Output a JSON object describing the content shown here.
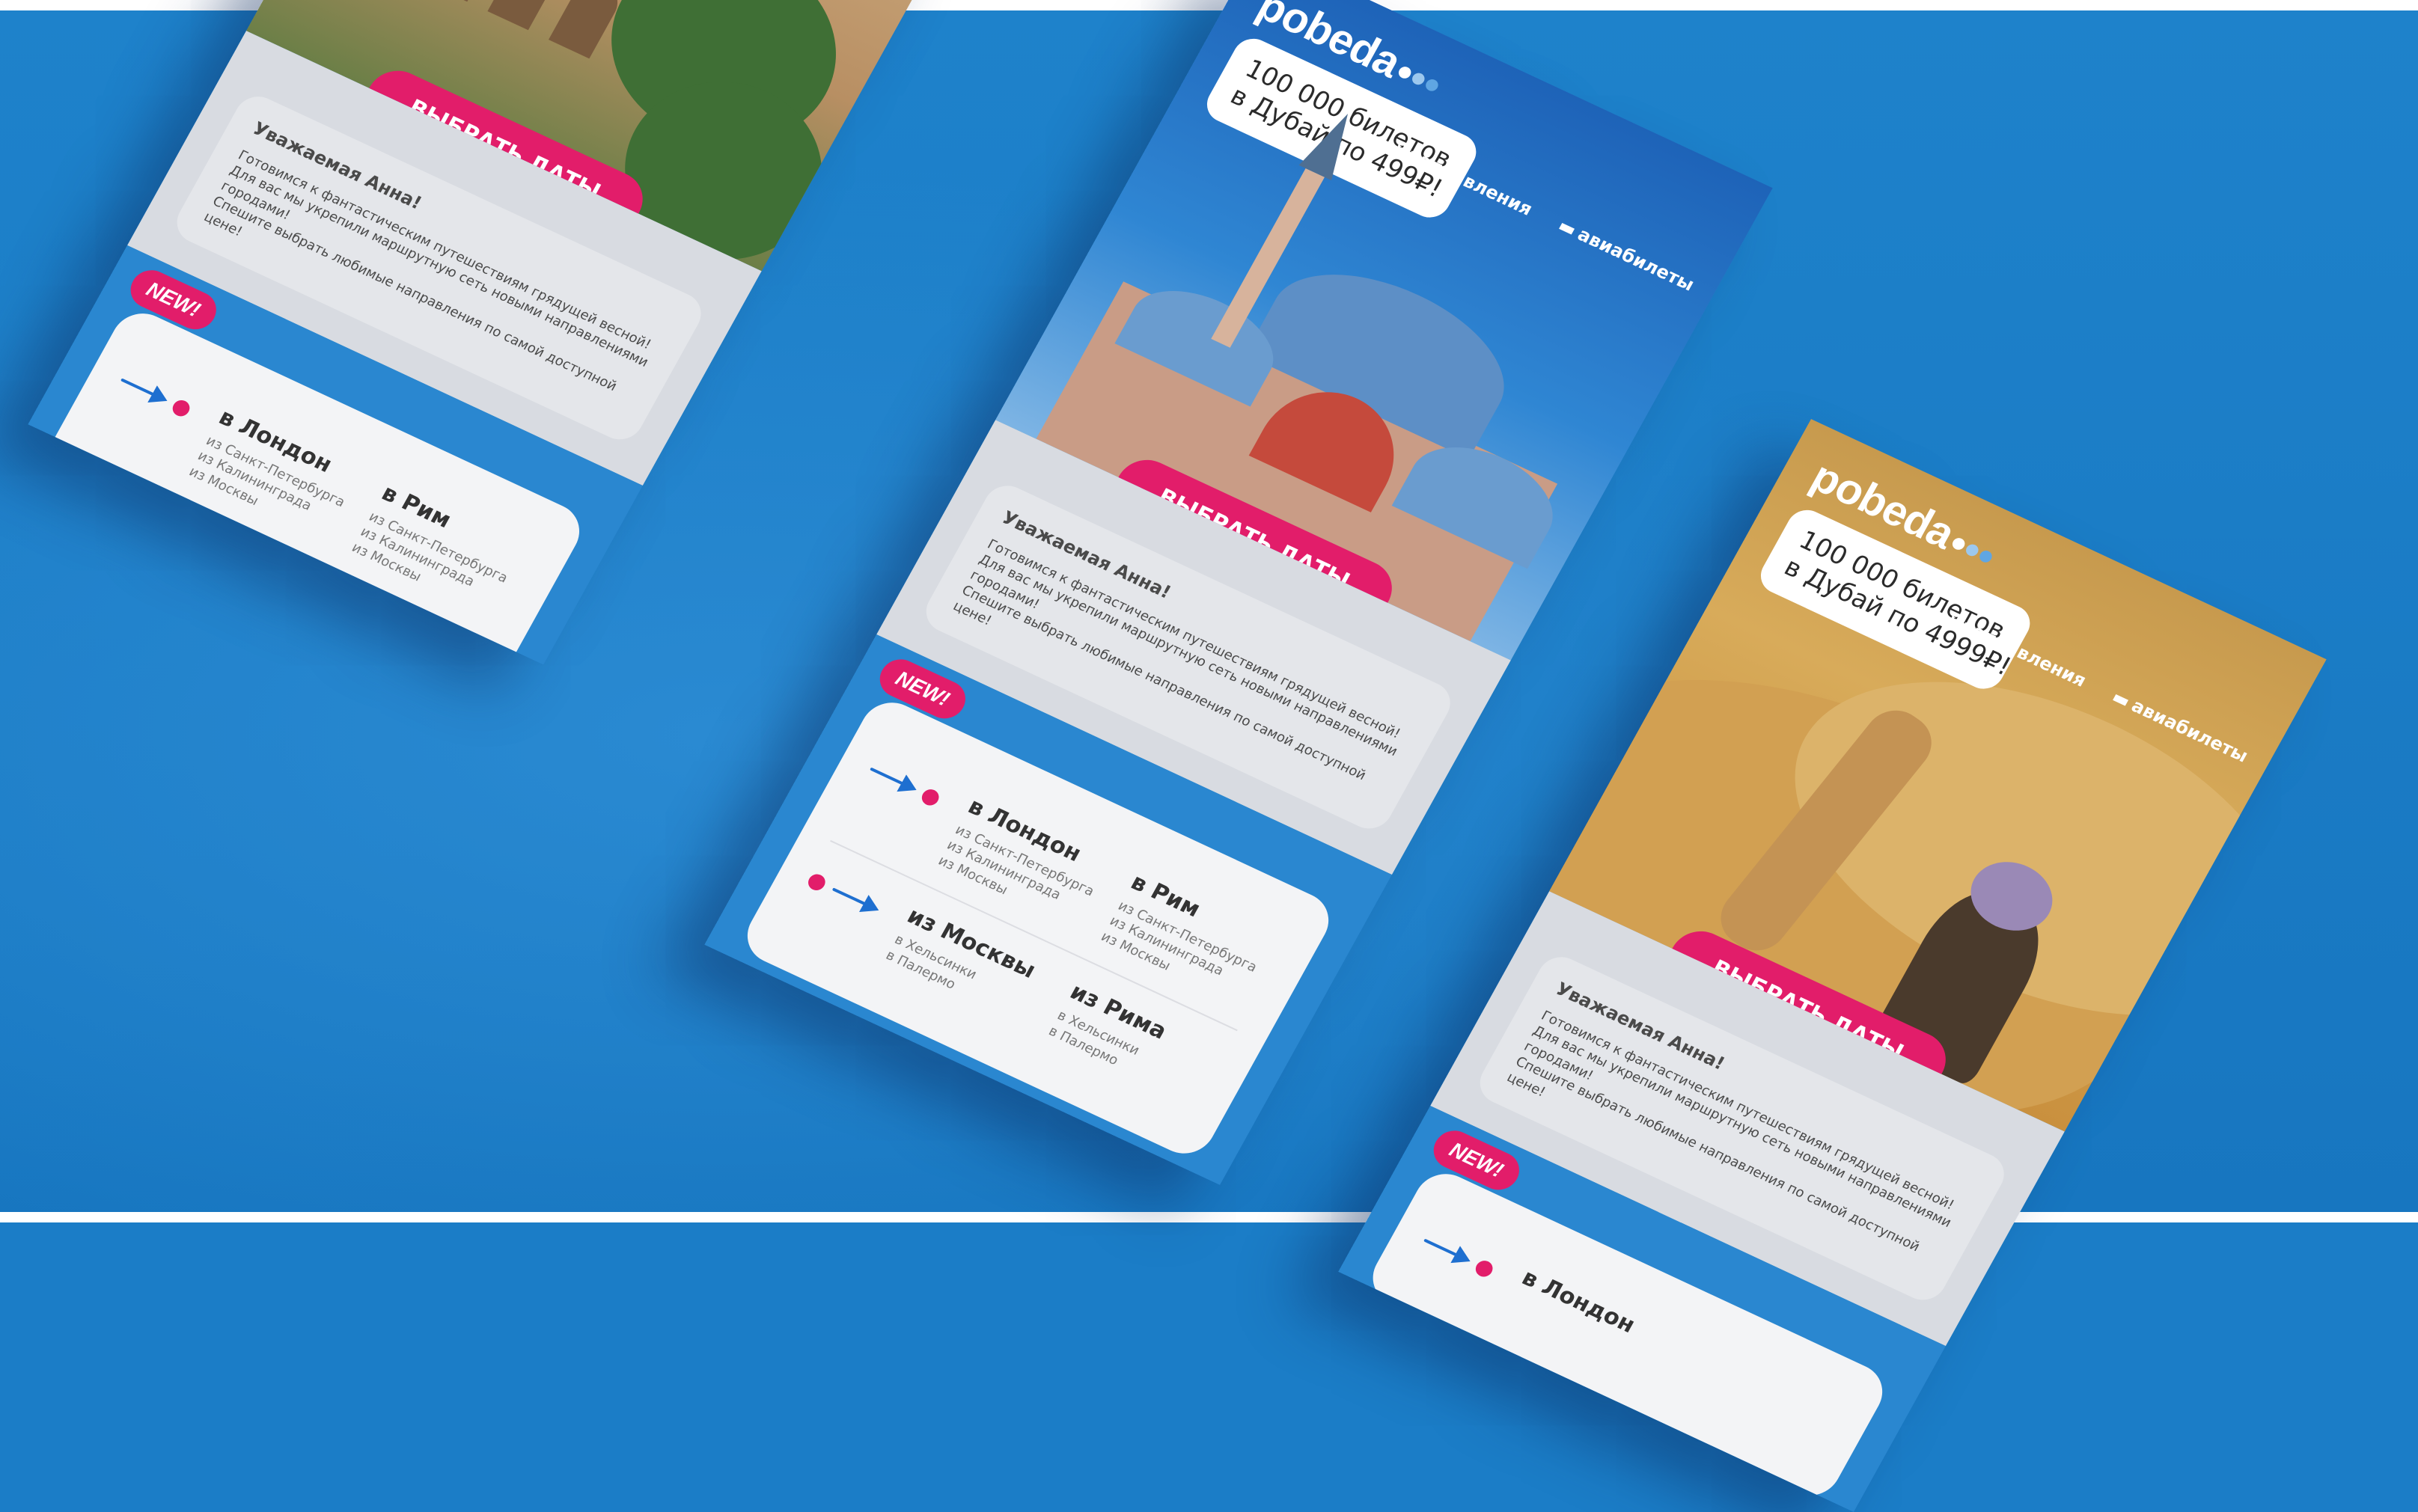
{
  "brand": {
    "name": "pobeda"
  },
  "nav": {
    "directions": "направления",
    "tickets": "авиабилеты"
  },
  "promo": {
    "dubai_line1": "100 000 билетов",
    "dubai_line2": "в Дубай по 499₽!",
    "desert_line1": "100 000 билетов",
    "desert_line2": "в Дубай по 4999₽!"
  },
  "cta_label": "ВЫБРАТЬ ДАТЫ",
  "greeting": {
    "hello": "Уважаемая Анна!",
    "line1": "Готовимся к фантастическим путешествиям грядущей весной!",
    "line2": "Для вас мы укрепили маршрутную сеть новыми направлениями городами!",
    "line3": "Спешите выбрать любимые направления по самой доступной цене!"
  },
  "new_badge": "NEW!",
  "routes": {
    "london": {
      "title": "в Лондон",
      "sub1": "из Санкт-Петербурга",
      "sub2": "из Калининграда",
      "sub3": "из Москвы"
    },
    "rome": {
      "title": "в Рим",
      "sub1": "из Санкт-Петербурга",
      "sub2": "из Калининграда",
      "sub3": "из Москвы"
    },
    "moscow": {
      "title": "из Москвы",
      "sub1": "в Хельсинки",
      "sub2": "в Палермо"
    },
    "from_rome": {
      "title": "из Рима",
      "sub1": "в Хельсинки",
      "sub2": "в Палермо"
    }
  },
  "colors": {
    "background": "#1b7dc7",
    "accent": "#e21d6a",
    "brand_blue": "#1e6fd0",
    "card_light": "#f3f4f6"
  }
}
